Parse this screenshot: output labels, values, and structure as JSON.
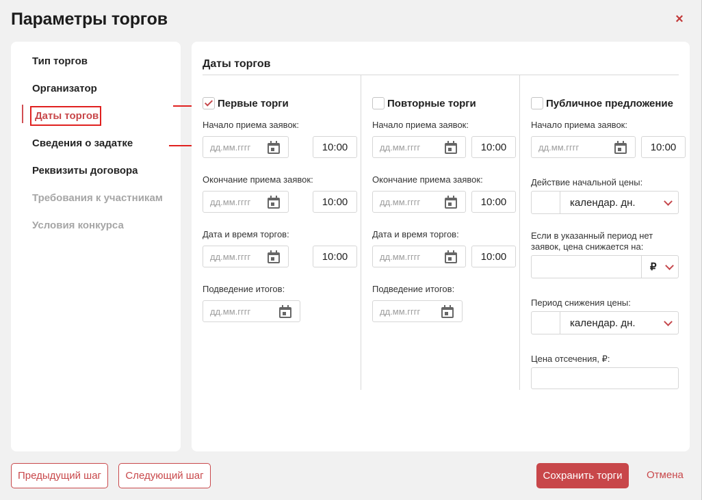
{
  "dialog": {
    "title": "Параметры торгов",
    "close_symbol": "×"
  },
  "sidebar": {
    "items": [
      {
        "label": "Тип торгов",
        "state": "normal"
      },
      {
        "label": "Организатор",
        "state": "normal"
      },
      {
        "label": "Даты торгов",
        "state": "active"
      },
      {
        "label": "Сведения о задатке",
        "state": "normal"
      },
      {
        "label": "Реквизиты договора",
        "state": "normal"
      },
      {
        "label": "Требования к участникам",
        "state": "disabled"
      },
      {
        "label": "Условия конкурса",
        "state": "disabled"
      }
    ]
  },
  "panel": {
    "title": "Даты торгов",
    "date_placeholder": "дд.мм.гггг",
    "columns": [
      {
        "heading": "Первые торги",
        "checked": true,
        "fields": [
          {
            "label": "Начало приема заявок:",
            "time": "10:00"
          },
          {
            "label": "Окончание приема заявок:",
            "time": "10:00"
          },
          {
            "label": "Дата и время торгов:",
            "time": "10:00"
          },
          {
            "label": "Подведение итогов:"
          }
        ]
      },
      {
        "heading": "Повторные торги",
        "checked": false,
        "fields": [
          {
            "label": "Начало приема заявок:",
            "time": "10:00"
          },
          {
            "label": "Окончание приема заявок:",
            "time": "10:00"
          },
          {
            "label": "Дата и время торгов:",
            "time": "10:00"
          },
          {
            "label": "Подведение итогов:"
          }
        ]
      },
      {
        "heading": "Публичное предложение",
        "checked": false,
        "start_label": "Начало приема заявок:",
        "start_time": "10:00",
        "initial_price_label": "Действие начальной цены:",
        "initial_price_unit": "календар. дн.",
        "decrease_label": "Если в указанный период нет заявок, цена снижается на:",
        "currency": "₽",
        "period_label": "Период снижения цены:",
        "period_unit": "календар. дн.",
        "cutoff_label": "Цена отсечения, ₽:"
      }
    ]
  },
  "footer": {
    "prev_label": "Предыдущий шаг",
    "next_label": "Следующий шаг",
    "save_label": "Сохранить торги",
    "cancel_label": "Отмена"
  },
  "colors": {
    "accent": "#c8474a",
    "annotation": "#e0201e"
  }
}
